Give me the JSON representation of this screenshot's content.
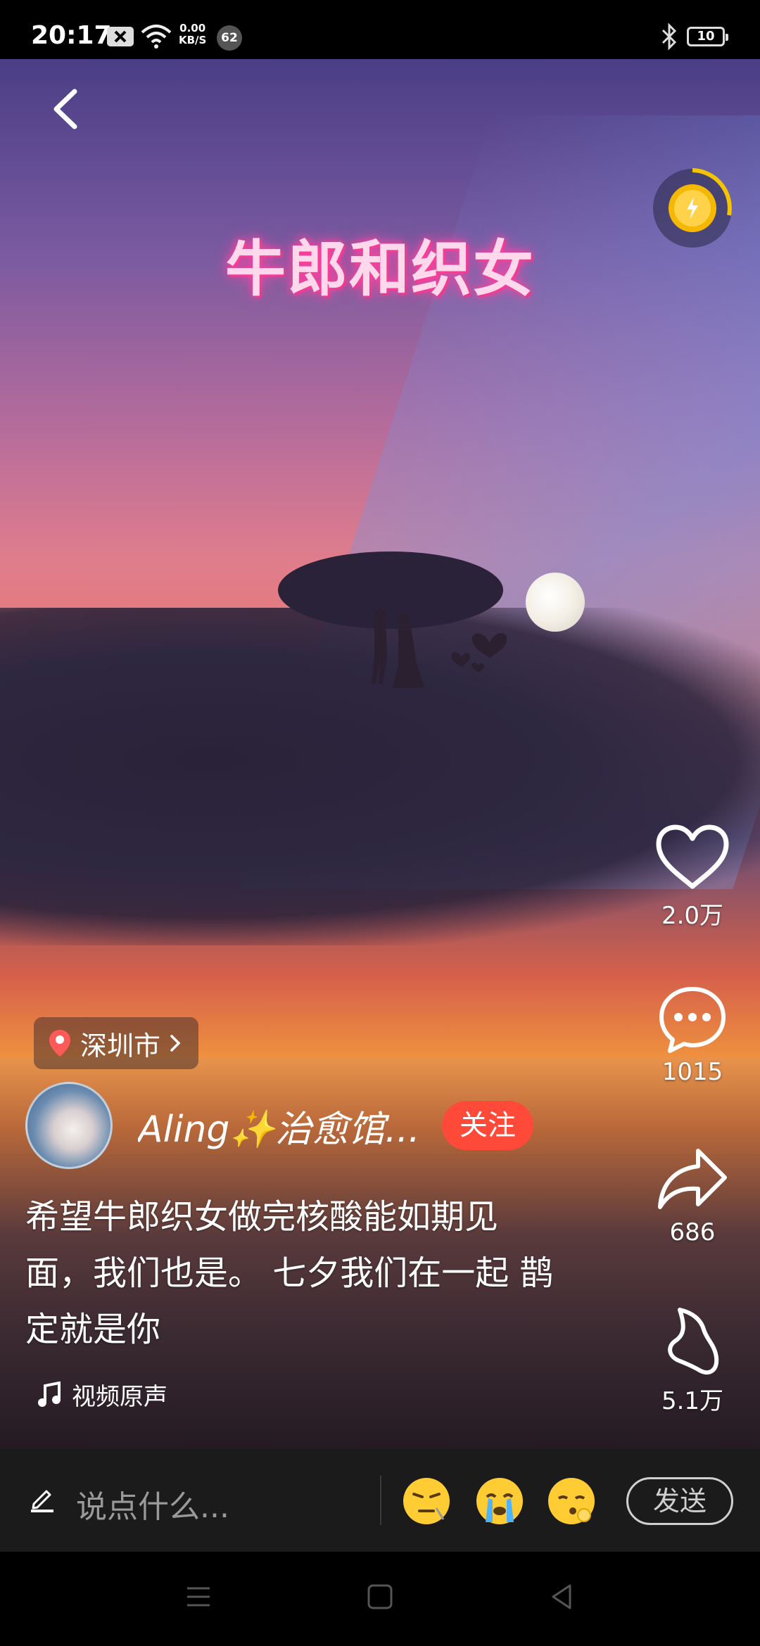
{
  "status_bar": {
    "time": "20:17",
    "net_speed_value": "0.00",
    "net_speed_unit": "KB/S",
    "notification_count": "62",
    "battery_level": "10"
  },
  "video": {
    "overlay_title": "牛郎和织女"
  },
  "actions": {
    "like_count": "2.0万",
    "comment_count": "1015",
    "share_count": "686",
    "collect_count": "5.1万"
  },
  "post": {
    "location": "深圳市",
    "author_name": "Aling✨治愈馆...",
    "follow_label": "关注",
    "caption": "希望牛郎织女做完核酸能如期见面，我们也是。 七夕我们在一起 鹊定就是你",
    "music": "视频原声"
  },
  "comment_bar": {
    "placeholder": "说点什么...",
    "send_label": "发送"
  },
  "colors": {
    "follow_button": "#ff4a3a",
    "title_glow": "#ff3d9a",
    "coin": "#f5b800"
  }
}
